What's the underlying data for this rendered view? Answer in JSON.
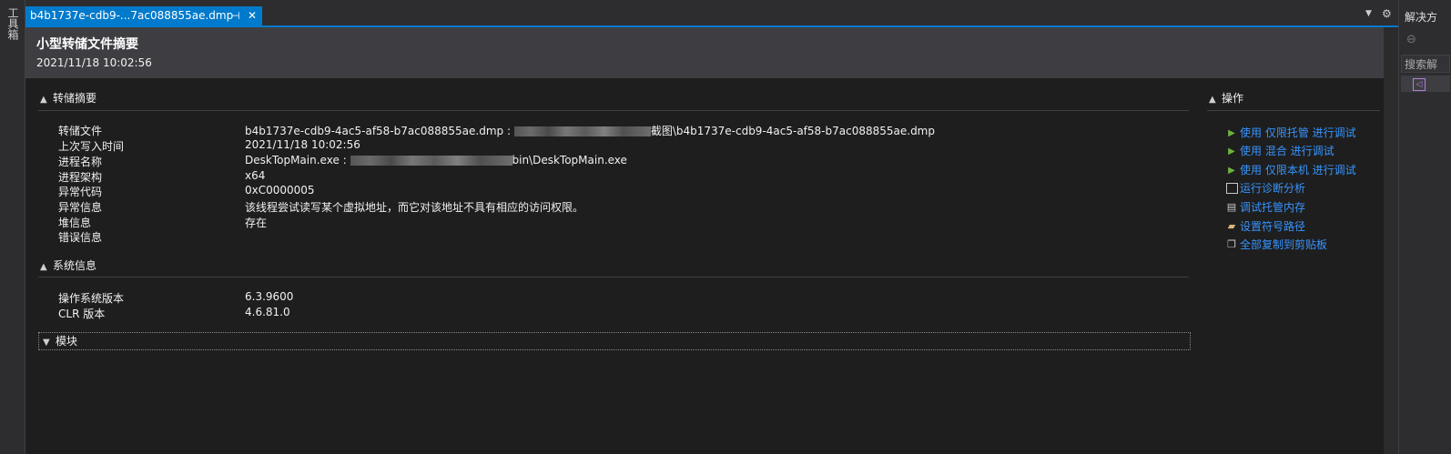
{
  "left_panel": {
    "label": "工具箱"
  },
  "right_panel": {
    "title": "解决方",
    "search": "搜索解",
    "nav_back": "⊖"
  },
  "tab": {
    "title": "b4b1737e-cdb9-...7ac088855ae.dmp",
    "pin": "⊣",
    "close": "✕"
  },
  "tabbar": {
    "dropdown": "▼",
    "gear": "⚙"
  },
  "header": {
    "title": "小型转储文件摘要",
    "date": "2021/11/18 10:02:56"
  },
  "dump_summary": {
    "heading": "转储摘要",
    "rows": [
      {
        "label": "转储文件",
        "value_prefix": "b4b1737e-cdb9-4ac5-af58-b7ac088855ae.dmp : ",
        "value_suffix": "截图\\b4b1737e-cdb9-4ac5-af58-b7ac088855ae.dmp"
      },
      {
        "label": "上次写入时间",
        "value": "2021/11/18 10:02:56"
      },
      {
        "label": "进程名称",
        "value_prefix": "DeskTopMain.exe : ",
        "value_suffix": "bin\\DeskTopMain.exe"
      },
      {
        "label": "进程架构",
        "value": "x64"
      },
      {
        "label": "异常代码",
        "value": "0xC0000005"
      },
      {
        "label": "异常信息",
        "value": "该线程尝试读写某个虚拟地址，而它对该地址不具有相应的访问权限。"
      },
      {
        "label": "堆信息",
        "value": "存在"
      },
      {
        "label": "错误信息",
        "value": ""
      }
    ]
  },
  "system_info": {
    "heading": "系统信息",
    "rows": [
      {
        "label": "操作系统版本",
        "value": "6.3.9600"
      },
      {
        "label": "CLR 版本",
        "value": "4.6.81.0"
      }
    ]
  },
  "modules": {
    "heading": "模块"
  },
  "actions": {
    "heading": "操作",
    "items": [
      {
        "label": "使用 仅限托管 进行调试",
        "icon": "play-icon"
      },
      {
        "label": "使用 混合 进行调试",
        "icon": "play-icon"
      },
      {
        "label": "使用 仅限本机 进行调试",
        "icon": "play-icon"
      },
      {
        "label": "运行诊断分析",
        "icon": "diagnostics-icon"
      },
      {
        "label": "调试托管内存",
        "icon": "memory-icon"
      },
      {
        "label": "设置符号路径",
        "icon": "symbol-path-icon"
      },
      {
        "label": "全部复制到剪贴板",
        "icon": "copy-icon"
      }
    ]
  },
  "colors": {
    "accent": "#007acc",
    "link": "#3794ff",
    "play": "#6db33f",
    "background": "#1e1e1e",
    "header": "#3e3e42"
  }
}
